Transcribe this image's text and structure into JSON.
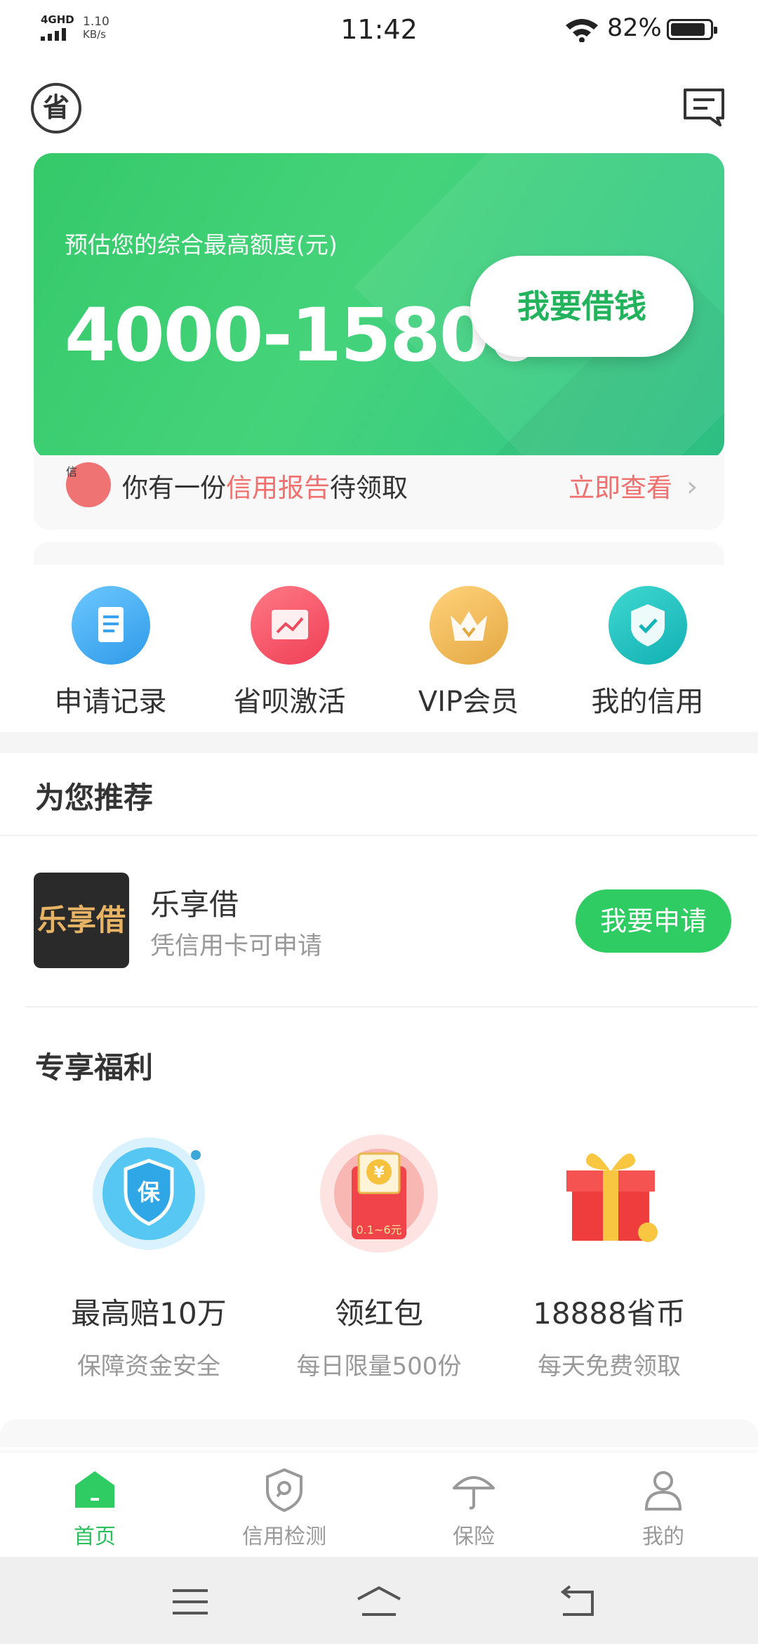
{
  "status_bar": {
    "network": "4GHD",
    "speed_value": "1.10",
    "speed_unit": "KB/s",
    "time": "11:42",
    "battery": "82%"
  },
  "header": {
    "logo_char": "省"
  },
  "hero": {
    "label": "预估您的综合最高额度(元)",
    "amount": "4000-15800",
    "button": "我要借钱"
  },
  "notice": {
    "icon_char": "信",
    "prefix": "你有一份",
    "highlight": "信用报告",
    "suffix": "待领取",
    "link": "立即查看",
    "arrow": "›"
  },
  "quick_actions": [
    {
      "label": "申请记录",
      "icon": "document-icon",
      "color": "#3aa7f0"
    },
    {
      "label": "省呗激活",
      "icon": "chart-icon",
      "color": "#f2586a"
    },
    {
      "label": "VIP会员",
      "icon": "crown-icon",
      "color": "#ecb04f"
    },
    {
      "label": "我的信用",
      "icon": "shield-check-icon",
      "color": "#1fc0c0"
    }
  ],
  "recommend": {
    "title": "为您推荐",
    "item": {
      "logo_text": "乐享借",
      "name": "乐享借",
      "subtitle": "凭信用卡可申请",
      "button": "我要申请"
    }
  },
  "benefits": {
    "title": "专享福利",
    "items": [
      {
        "title": "最高赔10万",
        "subtitle": "保障资金安全",
        "icon": "insurance-shield-icon",
        "badge": "保"
      },
      {
        "title": "领红包",
        "subtitle": "每日限量500份",
        "icon": "red-envelope-icon",
        "badge": "0.1~6元",
        "coin": "¥"
      },
      {
        "title": "18888省币",
        "subtitle": "每天免费领取",
        "icon": "gift-box-icon"
      }
    ]
  },
  "tabs": [
    {
      "label": "首页",
      "icon": "home-icon",
      "active": true
    },
    {
      "label": "信用检测",
      "icon": "credit-check-icon",
      "active": false
    },
    {
      "label": "保险",
      "icon": "umbrella-icon",
      "active": false
    },
    {
      "label": "我的",
      "icon": "user-icon",
      "active": false
    }
  ],
  "colors": {
    "primary": "#2ecc62",
    "accent_red": "#f07070"
  }
}
